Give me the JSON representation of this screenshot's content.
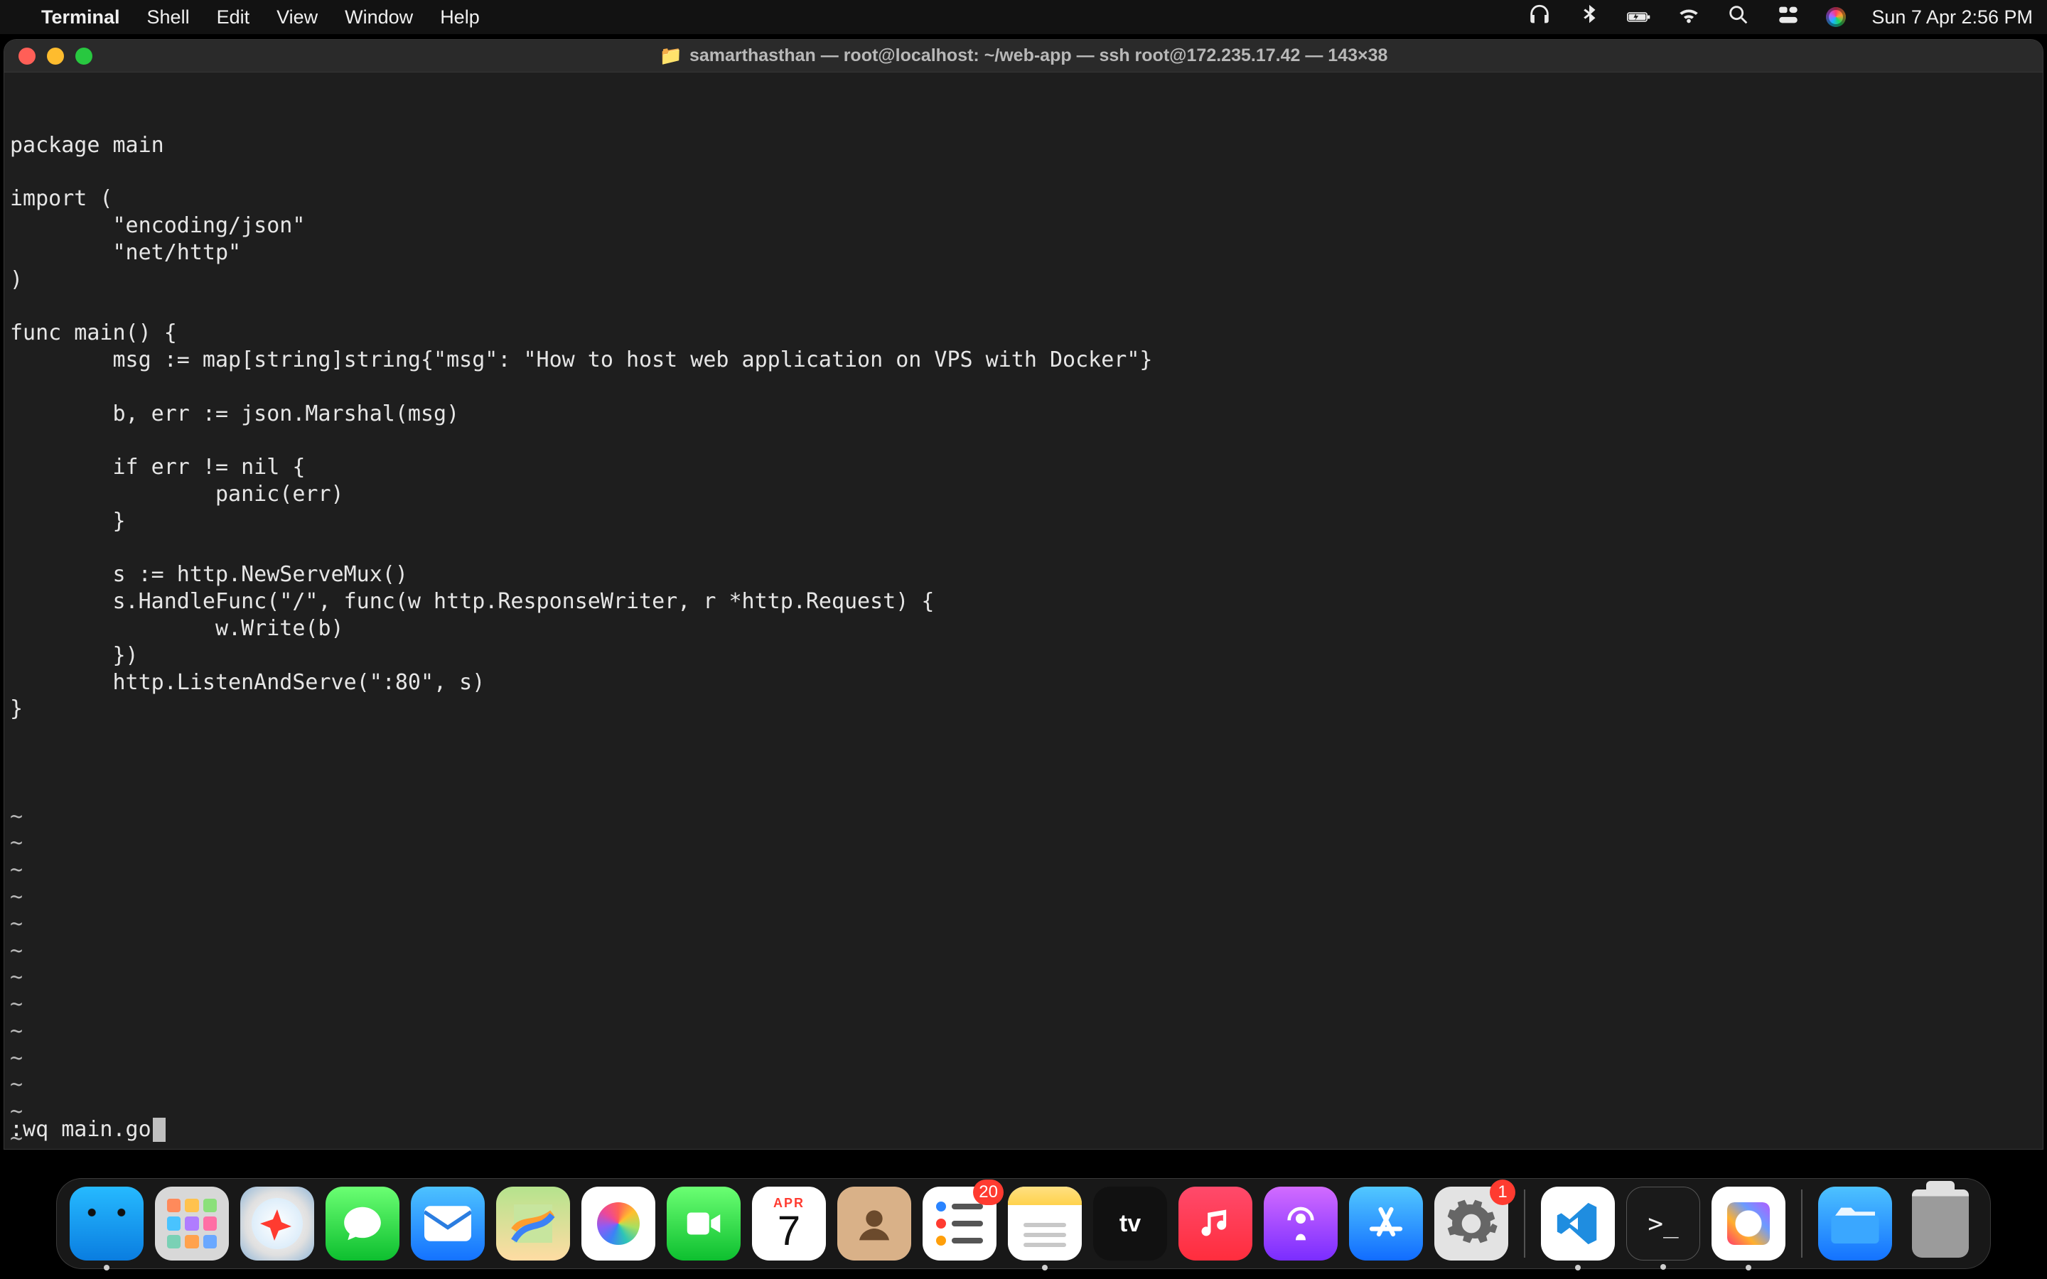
{
  "menubar": {
    "app": "Terminal",
    "items": [
      "Shell",
      "Edit",
      "View",
      "Window",
      "Help"
    ],
    "datetime": "Sun 7 Apr  2:56 PM"
  },
  "window": {
    "title": "samarthasthan — root@localhost: ~/web-app — ssh root@172.235.17.42 — 143×38"
  },
  "editor": {
    "code": "package main\n\nimport (\n        \"encoding/json\"\n        \"net/http\"\n)\n\nfunc main() {\n        msg := map[string]string{\"msg\": \"How to host web application on VPS with Docker\"}\n\n        b, err := json.Marshal(msg)\n\n        if err != nil {\n                panic(err)\n        }\n\n        s := http.NewServeMux()\n        s.HandleFunc(\"/\", func(w http.ResponseWriter, r *http.Request) {\n                w.Write(b)\n        })\n        http.ListenAndServe(\":80\", s)\n}",
    "tilde_rows": 13,
    "command": ":wq main.go"
  },
  "calendar": {
    "month": "APR",
    "day": "7"
  },
  "dock": {
    "items": [
      {
        "name": "finder",
        "label": "Finder",
        "running": true
      },
      {
        "name": "launchpad",
        "label": "Launchpad",
        "running": false
      },
      {
        "name": "safari",
        "label": "Safari",
        "running": false
      },
      {
        "name": "messages",
        "label": "Messages",
        "running": false
      },
      {
        "name": "mail",
        "label": "Mail",
        "running": false
      },
      {
        "name": "maps",
        "label": "Maps",
        "running": false
      },
      {
        "name": "photos",
        "label": "Photos",
        "running": false
      },
      {
        "name": "facetime",
        "label": "FaceTime",
        "running": false
      },
      {
        "name": "calendar",
        "label": "Calendar",
        "running": false
      },
      {
        "name": "contacts",
        "label": "Contacts",
        "running": false
      },
      {
        "name": "reminders",
        "label": "Reminders",
        "running": false,
        "badge": "20"
      },
      {
        "name": "notes",
        "label": "Notes",
        "running": true
      },
      {
        "name": "tv",
        "label": "Apple TV",
        "running": false
      },
      {
        "name": "music",
        "label": "Music",
        "running": false
      },
      {
        "name": "podcasts",
        "label": "Podcasts",
        "running": false
      },
      {
        "name": "appstore",
        "label": "App Store",
        "running": false
      },
      {
        "name": "settings",
        "label": "System Settings",
        "running": false,
        "badge": "1"
      }
    ],
    "extra": [
      {
        "name": "vscode",
        "label": "Visual Studio Code",
        "running": true
      },
      {
        "name": "terminal",
        "label": "Terminal",
        "running": true
      },
      {
        "name": "arc",
        "label": "Arc",
        "running": true
      }
    ],
    "tail": [
      {
        "name": "downloads",
        "label": "Downloads"
      },
      {
        "name": "trash",
        "label": "Trash"
      }
    ]
  }
}
